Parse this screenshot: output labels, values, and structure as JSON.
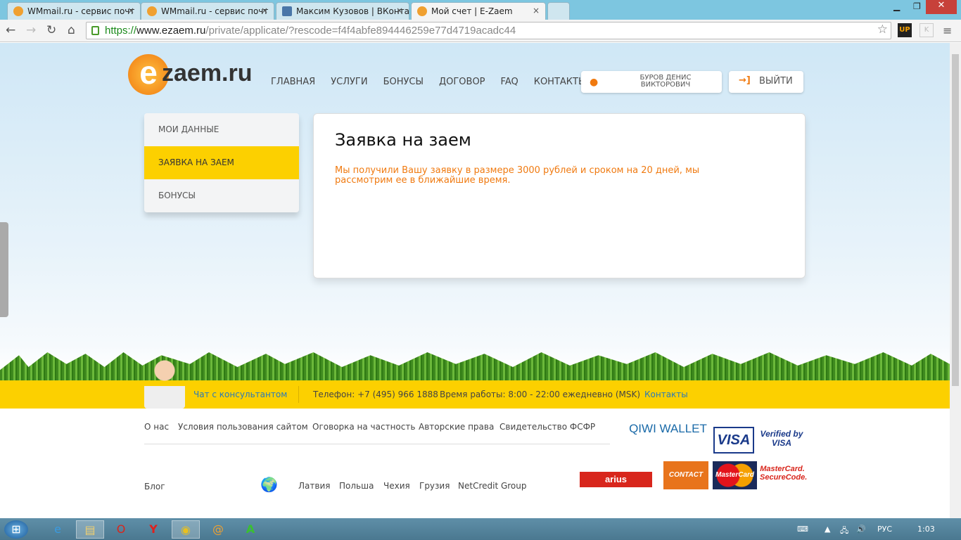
{
  "browser": {
    "tabs": [
      {
        "title": "WMmail.ru - сервис почт"
      },
      {
        "title": "WMmail.ru - сервис почт"
      },
      {
        "title": "Максим Кузовов | ВКонта"
      },
      {
        "title": "Мой счет | E-Zaem"
      }
    ],
    "url": {
      "scheme": "https://",
      "host": "www.ezaem.ru",
      "path": "/private/applicate/?rescode=f4f4abfe894446259e77d4719acadc44"
    }
  },
  "header": {
    "logo": "zaem.ru",
    "nav": [
      "ГЛАВНАЯ",
      "УСЛУГИ",
      "БОНУСЫ",
      "ДОГОВОР",
      "FAQ",
      "КОНТАКТЫ"
    ],
    "user_line1": "БУРОВ ДЕНИС",
    "user_line2": "ВИКТОРОВИЧ",
    "logout": "ВЫЙТИ"
  },
  "sidebar": {
    "items": [
      {
        "label": "МОИ ДАННЫЕ"
      },
      {
        "label": "ЗАЯВКА НА ЗАЕМ",
        "active": true
      },
      {
        "label": "БОНУСЫ"
      }
    ]
  },
  "main": {
    "title": "Заявка на заем",
    "message": "Мы получили Вашу заявку в размере 3000 рублей и сроком на 20 дней, мы рассмотрим ее в ближайшие время."
  },
  "contact_bar": {
    "chat": "Чат с консультантом",
    "phone": "Телефон: +7 (495) 966 1888",
    "hours": "Время работы: 8:00 - 22:00 ежедневно (MSK)",
    "contacts": "Контакты"
  },
  "footer": {
    "links": [
      "О нас",
      "Условия пользования сайтом",
      "Оговорка на частность",
      "Авторские права",
      "Свидетельство ФСФР"
    ],
    "blog": "Блог",
    "countries": [
      "Латвия",
      "Польша",
      "Чехия",
      "Грузия",
      "NetCredit Group"
    ],
    "payments": [
      "QIWI WALLET",
      "VISA",
      "Verified by VISA",
      "arius",
      "CONTACT",
      "MasterCard",
      "MasterCard. SecureCode."
    ]
  },
  "taskbar": {
    "lang": "РУС",
    "time": "1:03"
  },
  "colors": {
    "accent": "#f07a10",
    "yellow": "#fcd000"
  }
}
